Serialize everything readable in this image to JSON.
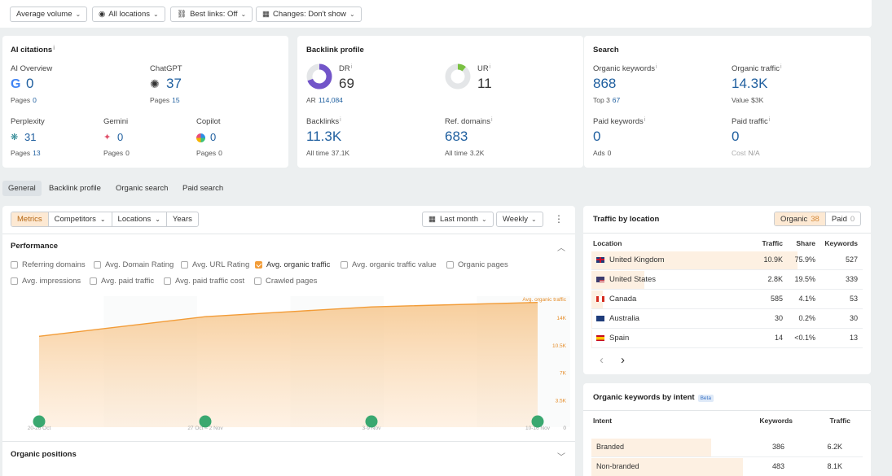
{
  "filters": {
    "volume": "Average volume",
    "locations": "All locations",
    "best_links": "Best links: Off",
    "changes": "Changes: Don't show"
  },
  "ai_citations": {
    "title": "AI citations",
    "ai_overview": {
      "label": "AI Overview",
      "value": "0",
      "pages_label": "Pages",
      "pages": "0"
    },
    "chatgpt": {
      "label": "ChatGPT",
      "value": "37",
      "pages_label": "Pages",
      "pages": "15"
    },
    "perplexity": {
      "label": "Perplexity",
      "value": "31",
      "pages_label": "Pages",
      "pages": "13"
    },
    "gemini": {
      "label": "Gemini",
      "value": "0",
      "pages_label": "Pages",
      "pages": "0"
    },
    "copilot": {
      "label": "Copilot",
      "value": "0",
      "pages_label": "Pages",
      "pages": "0"
    }
  },
  "backlink_profile": {
    "title": "Backlink profile",
    "dr": {
      "label": "DR",
      "value": "69",
      "ar_label": "AR",
      "ar": "114,084",
      "fill": 0.69
    },
    "ur": {
      "label": "UR",
      "value": "11",
      "fill": 0.11
    },
    "backlinks": {
      "label": "Backlinks",
      "value": "11.3K",
      "sub_label": "All time",
      "sub": "37.1K"
    },
    "ref_domains": {
      "label": "Ref. domains",
      "value": "683",
      "sub_label": "All time",
      "sub": "3.2K"
    }
  },
  "search": {
    "title": "Search",
    "organic_keywords": {
      "label": "Organic keywords",
      "value": "868",
      "sub_label": "Top 3",
      "sub": "67"
    },
    "organic_traffic": {
      "label": "Organic traffic",
      "value": "14.3K",
      "sub_label": "Value",
      "sub": "$3K"
    },
    "paid_keywords": {
      "label": "Paid keywords",
      "value": "0",
      "sub_label": "Ads",
      "sub": "0"
    },
    "paid_traffic": {
      "label": "Paid traffic",
      "value": "0",
      "sub_label": "Cost",
      "sub": "N/A"
    }
  },
  "tabs": [
    "General",
    "Backlink profile",
    "Organic search",
    "Paid search"
  ],
  "metrics_toolbar": {
    "segments": [
      "Metrics",
      "Competitors",
      "Locations",
      "Years"
    ],
    "period": "Last month",
    "granularity": "Weekly",
    "more": "⋮"
  },
  "performance": {
    "title": "Performance",
    "checkboxes": [
      {
        "label": "Referring domains",
        "checked": false
      },
      {
        "label": "Avg. Domain Rating",
        "checked": false
      },
      {
        "label": "Avg. URL Rating",
        "checked": false
      },
      {
        "label": "Avg. organic traffic",
        "checked": true
      },
      {
        "label": "Avg. organic traffic value",
        "checked": false
      },
      {
        "label": "Organic pages",
        "checked": false
      },
      {
        "label": "Avg. impressions",
        "checked": false
      },
      {
        "label": "Avg. paid traffic",
        "checked": false
      },
      {
        "label": "Avg. paid traffic cost",
        "checked": false
      },
      {
        "label": "Crawled pages",
        "checked": false
      }
    ]
  },
  "chart_data": {
    "type": "area",
    "series": [
      {
        "name": "Avg. organic traffic",
        "values": [
          10200,
          12400,
          13500,
          14000
        ]
      }
    ],
    "x": [
      "20-26 Oct",
      "27 Oct – 2 Nov",
      "3-9 Nov",
      "10-16 Nov"
    ],
    "y_ticks": [
      "14K",
      "10.5K",
      "7K",
      "3.5K",
      "0"
    ],
    "ylim": [
      0,
      14700
    ],
    "color": "#f29c38"
  },
  "organic_positions": {
    "title": "Organic positions"
  },
  "traffic_by_location": {
    "title": "Traffic by location",
    "toggle": {
      "organic": "Organic",
      "organic_count": "38",
      "paid": "Paid",
      "paid_count": "0"
    },
    "columns": [
      "Location",
      "Traffic",
      "Share",
      "Keywords"
    ],
    "rows": [
      {
        "country": "United Kingdom",
        "traffic": "10.9K",
        "share": "75.9%",
        "keywords": "527",
        "share_value": 75.9
      },
      {
        "country": "United States",
        "traffic": "2.8K",
        "share": "19.5%",
        "keywords": "339",
        "share_value": 19.5
      },
      {
        "country": "Canada",
        "traffic": "585",
        "share": "4.1%",
        "keywords": "53",
        "share_value": 4.1
      },
      {
        "country": "Australia",
        "traffic": "30",
        "share": "0.2%",
        "keywords": "30",
        "share_value": 0.2
      },
      {
        "country": "Spain",
        "traffic": "14",
        "share": "<0.1%",
        "keywords": "13",
        "share_value": 0.1
      }
    ],
    "prev": "‹",
    "next": "›"
  },
  "intent": {
    "title": "Organic keywords by intent",
    "badge": "Beta",
    "columns": [
      "Intent",
      "Keywords",
      "Traffic"
    ],
    "rows": [
      {
        "intent": "Branded",
        "keywords": "386",
        "traffic": "6.2K",
        "share_value": 44
      },
      {
        "intent": "Non-branded",
        "keywords": "483",
        "traffic": "8.1K",
        "share_value": 56
      }
    ]
  }
}
